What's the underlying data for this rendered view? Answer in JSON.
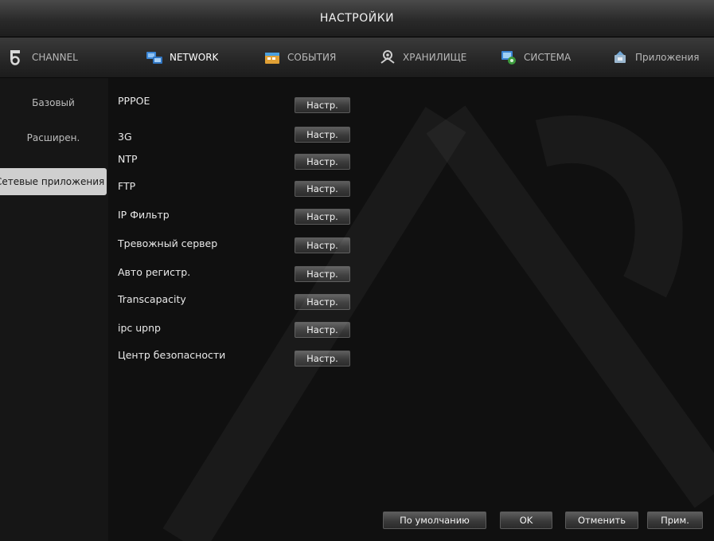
{
  "window": {
    "title": "НАСТРОЙКИ"
  },
  "tabs": [
    {
      "label": "CHANNEL",
      "icon": "channel-icon",
      "active": false
    },
    {
      "label": "NETWORK",
      "icon": "network-icon",
      "active": true
    },
    {
      "label": "СОБЫТИЯ",
      "icon": "events-icon",
      "active": false
    },
    {
      "label": "ХРАНИЛИЩЕ",
      "icon": "storage-icon",
      "active": false
    },
    {
      "label": "СИСТЕМА",
      "icon": "system-icon",
      "active": false
    },
    {
      "label": "Приложения",
      "icon": "apps-icon",
      "active": false
    }
  ],
  "sidebar": {
    "items": [
      {
        "label": "Базовый",
        "active": false
      },
      {
        "label": "Расширен.",
        "active": false
      },
      {
        "label": "Сетевые приложения",
        "active": true
      }
    ]
  },
  "rows": [
    {
      "label": "PPPOE",
      "button": "Настр."
    },
    {
      "label": "3G",
      "button": "Настр."
    },
    {
      "label": "NTP",
      "button": "Настр."
    },
    {
      "label": "FTP",
      "button": "Настр."
    },
    {
      "label": "IP Фильтр",
      "button": "Настр."
    },
    {
      "label": "Тревожный сервер",
      "button": "Настр."
    },
    {
      "label": "Авто регистр.",
      "button": "Настр."
    },
    {
      "label": "Transcapacity",
      "button": "Настр."
    },
    {
      "label": "ipc upnp",
      "button": "Настр."
    },
    {
      "label": "Центр безопасности",
      "button": "Настр."
    }
  ],
  "footer": {
    "default_label": "По умолчанию",
    "ok_label": "OK",
    "cancel_label": "Отменить",
    "apply_label": "Прим."
  },
  "colors": {
    "background": "#121212",
    "active_sidebar": "#cfcfcf",
    "button_face": "#3a3a3a"
  }
}
